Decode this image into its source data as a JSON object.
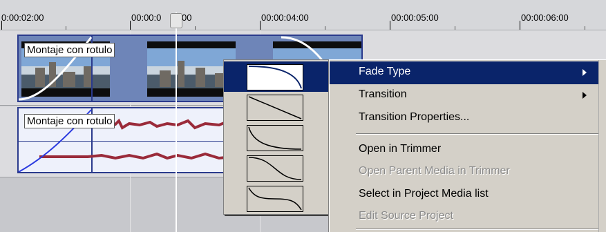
{
  "ruler": {
    "labels": [
      "0:00:02:00",
      "00:00:0",
      "00:00:04:00",
      "00:00:05:00",
      "00:00:06:00"
    ],
    "cursor_label_tail": "00"
  },
  "video_event": {
    "label": "Montaje con rotulo"
  },
  "audio_event": {
    "label": "Montaje con rotulo"
  },
  "fade_types": [
    {
      "name": "fast-fade-curve",
      "selected": true
    },
    {
      "name": "linear-fade-curve",
      "selected": false
    },
    {
      "name": "slow-fade-curve",
      "selected": false
    },
    {
      "name": "smooth-fade-curve",
      "selected": false
    },
    {
      "name": "sharp-fade-curve",
      "selected": false
    }
  ],
  "context_menu": {
    "fade_type": "Fade Type",
    "transition": "Transition",
    "transition_properties": "Transition Properties...",
    "open_in_trimmer": "Open in Trimmer",
    "open_parent_media": "Open Parent Media in Trimmer",
    "select_in_project_media": "Select in Project Media list",
    "edit_source_project": "Edit Source Project"
  },
  "colors": {
    "selection": "#0a246a",
    "menu_bg": "#d4d0c8",
    "audio_wave": "#9a2b3a",
    "event_border": "#2a3a8c"
  }
}
